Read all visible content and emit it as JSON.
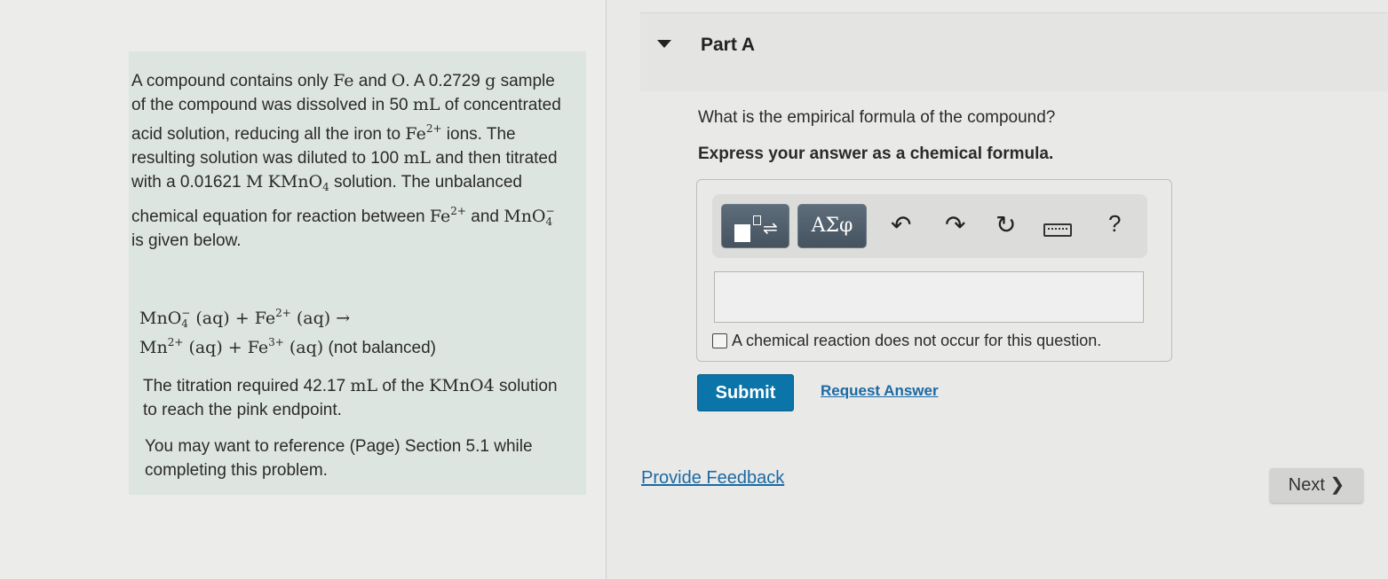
{
  "problem": {
    "p1": {
      "t1": "A compound contains only ",
      "fe": "Fe",
      "t2": " and ",
      "o": "O",
      "t3": ". A 0.2729 ",
      "g": "g",
      "t4": " sample of the compound was dissolved in 50 ",
      "ml": "mL",
      "t5": " of concentrated acid solution, reducing all the iron to ",
      "fe2": "Fe",
      "fe2_charge": "2+",
      "t6": " ions. The resulting solution was diluted to 100 ",
      "ml2": "mL",
      "t7": " and then titrated with a 0.01621 ",
      "m": "M",
      "kmno4": "KMnO",
      "kmno4_sub": "4",
      "t8": " solution. The unbalanced chemical equation for reaction between ",
      "fe3": "Fe",
      "fe3_charge": "2+",
      "t9": " and ",
      "mno4": "MnO",
      "mno4_charge": "−",
      "mno4_sub": "4",
      "t10": " is given below."
    },
    "equation": {
      "l1_a": "MnO",
      "l1_a_charge": "−",
      "l1_a_sub": "4",
      "l1_b": " (aq) + Fe",
      "l1_b_charge": "2+",
      "l1_c": " (aq) →",
      "l2_a": "Mn",
      "l2_a_charge": "2+",
      "l2_b": " (aq) + Fe",
      "l2_b_charge": "3+",
      "l2_c": " (aq)",
      "l2_note": " (not balanced)"
    },
    "p3": {
      "t1": "The titration required 42.17 ",
      "ml": "mL",
      "t2": " of the ",
      "kmno4": "KMnO4",
      "t3": " solution to reach the pink endpoint."
    },
    "p4": "You may want to reference (Page) Section 5.1 while completing this problem."
  },
  "part": {
    "title": "Part A",
    "question": "What is the empirical formula of the compound?",
    "instruction": "Express your answer as a chemical formula."
  },
  "toolbar": {
    "greek_label": "ΑΣφ",
    "templates_arrows": "⇌",
    "undo_glyph": "↶",
    "redo_glyph": "↷",
    "reset_glyph": "↻",
    "help_glyph": "?"
  },
  "answer": {
    "value": "",
    "no_reaction_label": "A chemical reaction does not occur for this question."
  },
  "actions": {
    "submit": "Submit",
    "request_answer": "Request Answer",
    "provide_feedback": "Provide Feedback",
    "next": "Next ❯"
  },
  "colors": {
    "problem_bg": "#dde5e1",
    "submit_bg": "#0b74a8",
    "link": "#1b6aa3"
  }
}
